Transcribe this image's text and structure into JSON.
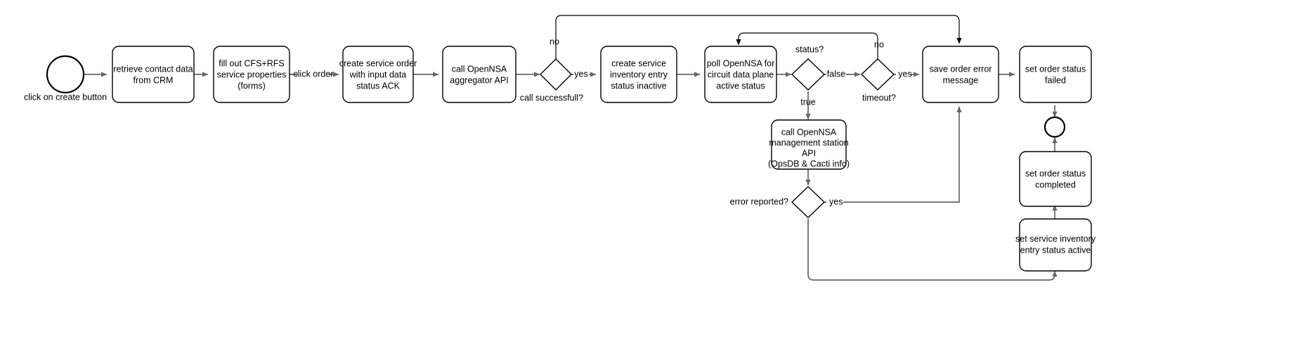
{
  "diagram": {
    "title": "service order provisioning flow",
    "type": "flowchart",
    "colors": {
      "node_stroke": "#000000",
      "node_fill": "#ffffff",
      "edge_stroke": "#666666",
      "text": "#000000"
    },
    "nodes": {
      "start_event": {
        "kind": "start-event",
        "label": "click on create button"
      },
      "retrieve_contact": {
        "kind": "task",
        "lines": [
          "retrieve contact data",
          "from CRM"
        ]
      },
      "fill_forms": {
        "kind": "task",
        "lines": [
          "fill out CFS+RFS",
          "service properties",
          "(forms)"
        ]
      },
      "create_order": {
        "kind": "task",
        "lines": [
          "create service order",
          "with input data",
          "status ACK"
        ]
      },
      "call_aggregator": {
        "kind": "task",
        "lines": [
          "call OpenNSA",
          "aggregator API"
        ]
      },
      "call_successful": {
        "kind": "gateway",
        "label": "call successfull?"
      },
      "create_inventory": {
        "kind": "task",
        "lines": [
          "create service",
          "inventory entry",
          "status inactive"
        ]
      },
      "poll_opennsa": {
        "kind": "task",
        "lines": [
          "poll OpenNSA for",
          "circuit data plane",
          "active status"
        ]
      },
      "status_gateway": {
        "kind": "gateway",
        "label": "status?"
      },
      "timeout_gateway": {
        "kind": "gateway",
        "label": "timeout?"
      },
      "save_error": {
        "kind": "task",
        "lines": [
          "save order error",
          "message"
        ]
      },
      "set_failed": {
        "kind": "task",
        "lines": [
          "set order status",
          "failed"
        ]
      },
      "call_mgmt": {
        "kind": "task",
        "lines": [
          "call OpenNSA",
          "management station",
          "API",
          "(OpsDB & Cacti info)"
        ]
      },
      "error_reported": {
        "kind": "gateway",
        "label": "error reported?"
      },
      "set_completed": {
        "kind": "task",
        "lines": [
          "set order status",
          "completed"
        ]
      },
      "set_inventory_active": {
        "kind": "task",
        "lines": [
          "set service inventory",
          "entry status active"
        ]
      },
      "end_event": {
        "kind": "end-event",
        "label": ""
      }
    },
    "edge_labels": {
      "click_order": "click order",
      "call_no": "no",
      "call_yes": "yes",
      "status_false": "false",
      "status_true": "true",
      "timeout_no": "no",
      "timeout_yes": "yes",
      "error_yes": "yes"
    }
  }
}
